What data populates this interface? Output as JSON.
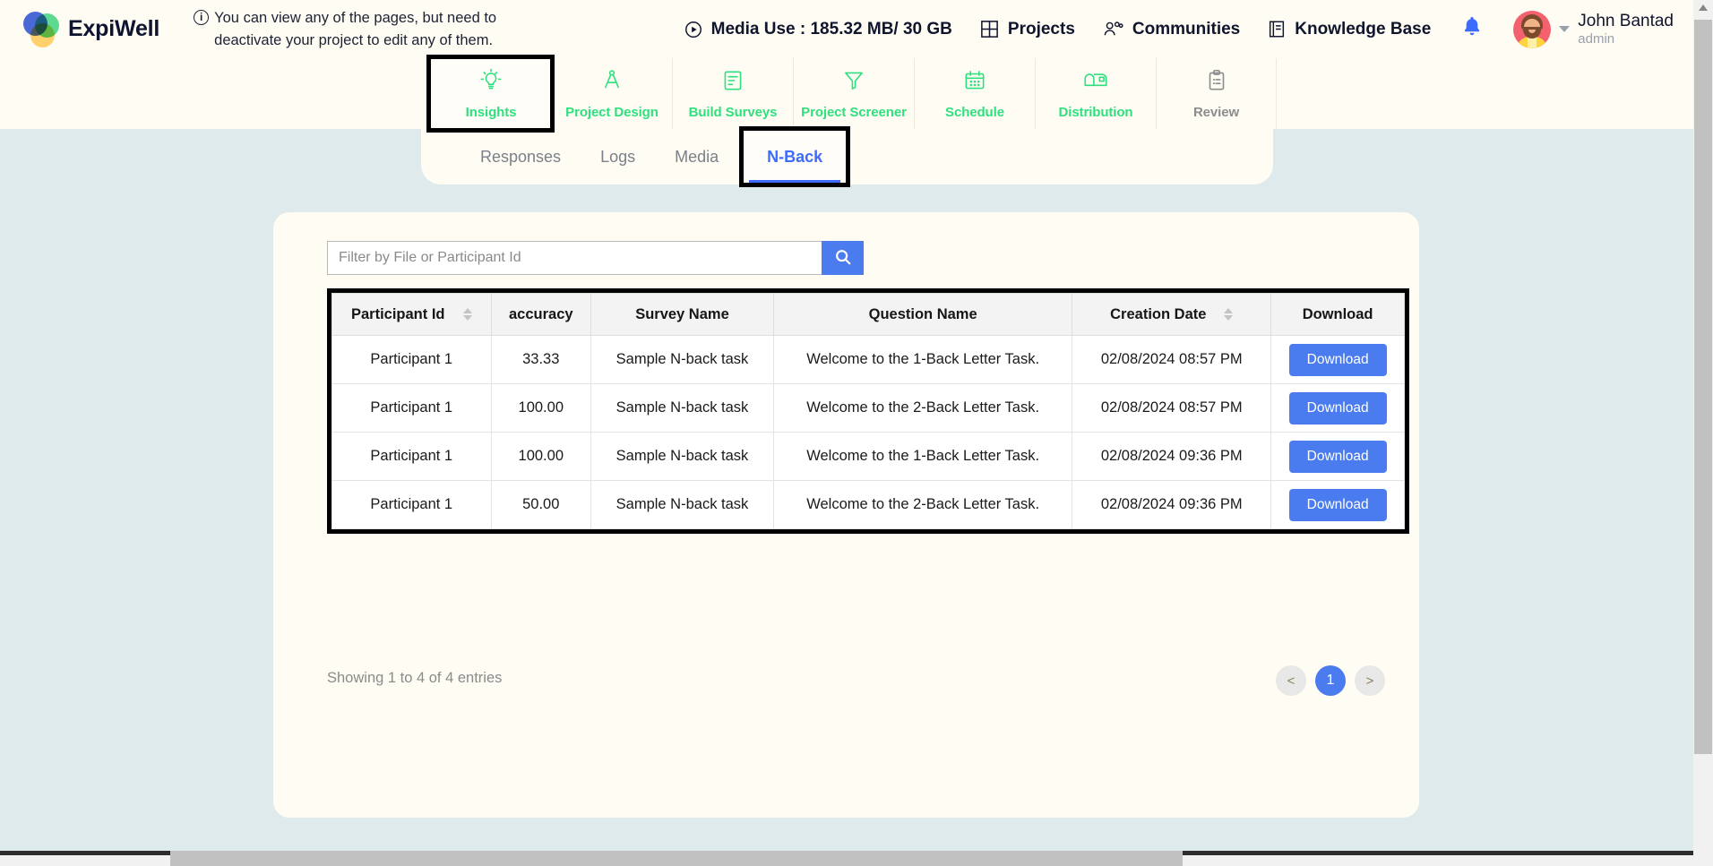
{
  "brand": {
    "name": "ExpiWell"
  },
  "notice": {
    "icon": "info-icon",
    "text": "You can view any of the pages, but need to deactivate your project to edit any of them."
  },
  "header": {
    "media_use": "Media Use : 185.32 MB/ 30 GB",
    "projects": "Projects",
    "communities": "Communities",
    "knowledge_base": "Knowledge Base",
    "user": {
      "name": "John Bantad",
      "role": "admin"
    }
  },
  "nav": {
    "items": [
      {
        "label": "Insights",
        "icon": "lightbulb-icon",
        "active": true,
        "highlighted": true
      },
      {
        "label": "Project Design",
        "icon": "compass-icon",
        "active": true,
        "highlighted": false
      },
      {
        "label": "Build Surveys",
        "icon": "document-lines-icon",
        "active": true,
        "highlighted": false
      },
      {
        "label": "Project Screener",
        "icon": "funnel-icon",
        "active": true,
        "highlighted": false
      },
      {
        "label": "Schedule",
        "icon": "calendar-icon",
        "active": true,
        "highlighted": false
      },
      {
        "label": "Distribution",
        "icon": "mailbox-icon",
        "active": true,
        "highlighted": false
      },
      {
        "label": "Review",
        "icon": "clipboard-icon",
        "active": false,
        "highlighted": false
      }
    ]
  },
  "subtabs": {
    "items": [
      {
        "label": "Responses",
        "active": false,
        "highlighted": false
      },
      {
        "label": "Logs",
        "active": false,
        "highlighted": false
      },
      {
        "label": "Media",
        "active": false,
        "highlighted": false
      },
      {
        "label": "N-Back",
        "active": true,
        "highlighted": true
      }
    ]
  },
  "filter": {
    "placeholder": "Filter by File or Participant Id",
    "value": "",
    "search_icon": "magnifier-icon"
  },
  "table": {
    "columns": [
      {
        "label": "Participant Id",
        "sortable": true
      },
      {
        "label": "accuracy",
        "sortable": false
      },
      {
        "label": "Survey Name",
        "sortable": false
      },
      {
        "label": "Question Name",
        "sortable": false
      },
      {
        "label": "Creation Date",
        "sortable": true
      },
      {
        "label": "Download",
        "sortable": false
      }
    ],
    "rows": [
      {
        "participant_id": "Participant 1",
        "accuracy": "33.33",
        "survey_name": "Sample N-back task",
        "question_name": "Welcome to the 1-Back Letter Task.",
        "creation_date": "02/08/2024 08:57 PM",
        "download_label": "Download"
      },
      {
        "participant_id": "Participant 1",
        "accuracy": "100.00",
        "survey_name": "Sample N-back task",
        "question_name": "Welcome to the 2-Back Letter Task.",
        "creation_date": "02/08/2024 08:57 PM",
        "download_label": "Download"
      },
      {
        "participant_id": "Participant 1",
        "accuracy": "100.00",
        "survey_name": "Sample N-back task",
        "question_name": "Welcome to the 1-Back Letter Task.",
        "creation_date": "02/08/2024 09:36 PM",
        "download_label": "Download"
      },
      {
        "participant_id": "Participant 1",
        "accuracy": "50.00",
        "survey_name": "Sample N-back task",
        "question_name": "Welcome to the 2-Back Letter Task.",
        "creation_date": "02/08/2024 09:36 PM",
        "download_label": "Download"
      }
    ]
  },
  "footer": {
    "showing": "Showing 1 to 4 of 4 entries",
    "pagination": {
      "prev": "<",
      "pages": [
        "1"
      ],
      "next": ">",
      "current": "1"
    }
  },
  "colors": {
    "page_background": "#dfeaec",
    "panel_background": "#fffcf4",
    "nav_active": "#2fe07e",
    "nav_inactive": "#8c8c8c",
    "accent_blue": "#4a7cf0",
    "subtab_active": "#3d6bfd",
    "highlight_box": "#000000"
  }
}
